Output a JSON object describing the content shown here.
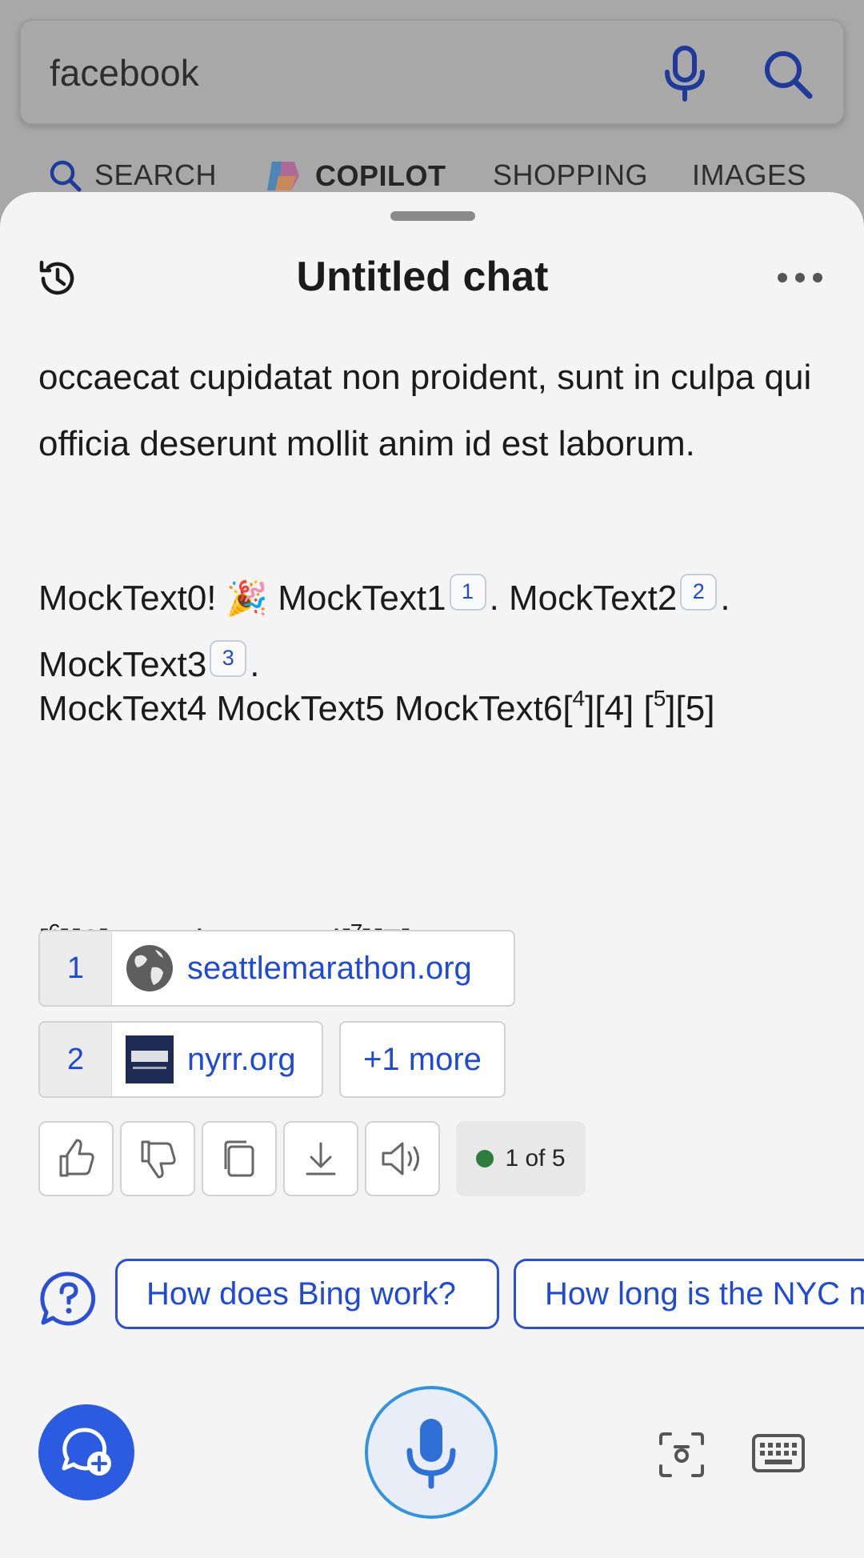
{
  "search": {
    "query": "facebook"
  },
  "scopes": [
    {
      "label": "SEARCH"
    },
    {
      "label": "COPILOT"
    },
    {
      "label": "SHOPPING"
    },
    {
      "label": "IMAGES"
    }
  ],
  "chat": {
    "title": "Untitled chat",
    "paragraph1": "occaecat cupidatat non proident, sunt in culpa qui officia deserunt mollit anim id est laborum.",
    "p2": {
      "t0": "MockText0! ",
      "emoji": "🎉",
      "t1": " MockText1",
      "c1": "1",
      "t2": ". MockText2",
      "c2": "2",
      "t3": ".",
      "t4": "MockText3",
      "c3": "3",
      "t5": "."
    },
    "p3": {
      "a": "MockText4 MockText5 MockText6[",
      "s4": "4",
      "b": "][4] [",
      "s5": "5",
      "c": "][5]"
    },
    "p4": {
      "a": "[",
      "s6": "6",
      "b": "][6]. MockTextEnd[",
      "s7": "7",
      "c": "][7]."
    }
  },
  "sources": [
    {
      "num": "1",
      "label": "seattlemarathon.org",
      "favicon": "globe-icon"
    },
    {
      "num": "2",
      "label": "nyrr.org",
      "favicon": "nyrr-logo"
    }
  ],
  "more_sources": "+1 more",
  "actions": [
    "thumbs-up-icon",
    "thumbs-down-icon",
    "copy-icon",
    "download-icon",
    "speaker-icon"
  ],
  "response_counter": "1 of 5",
  "suggestions": [
    {
      "label": "How does Bing work?"
    },
    {
      "label": "How long is the NYC marathon?"
    }
  ],
  "colors": {
    "accent": "#1f4ad9",
    "sheet_bg": "#f4f4f4",
    "scrim": "#a8a8a8",
    "status_dot": "#2f7d3e"
  }
}
